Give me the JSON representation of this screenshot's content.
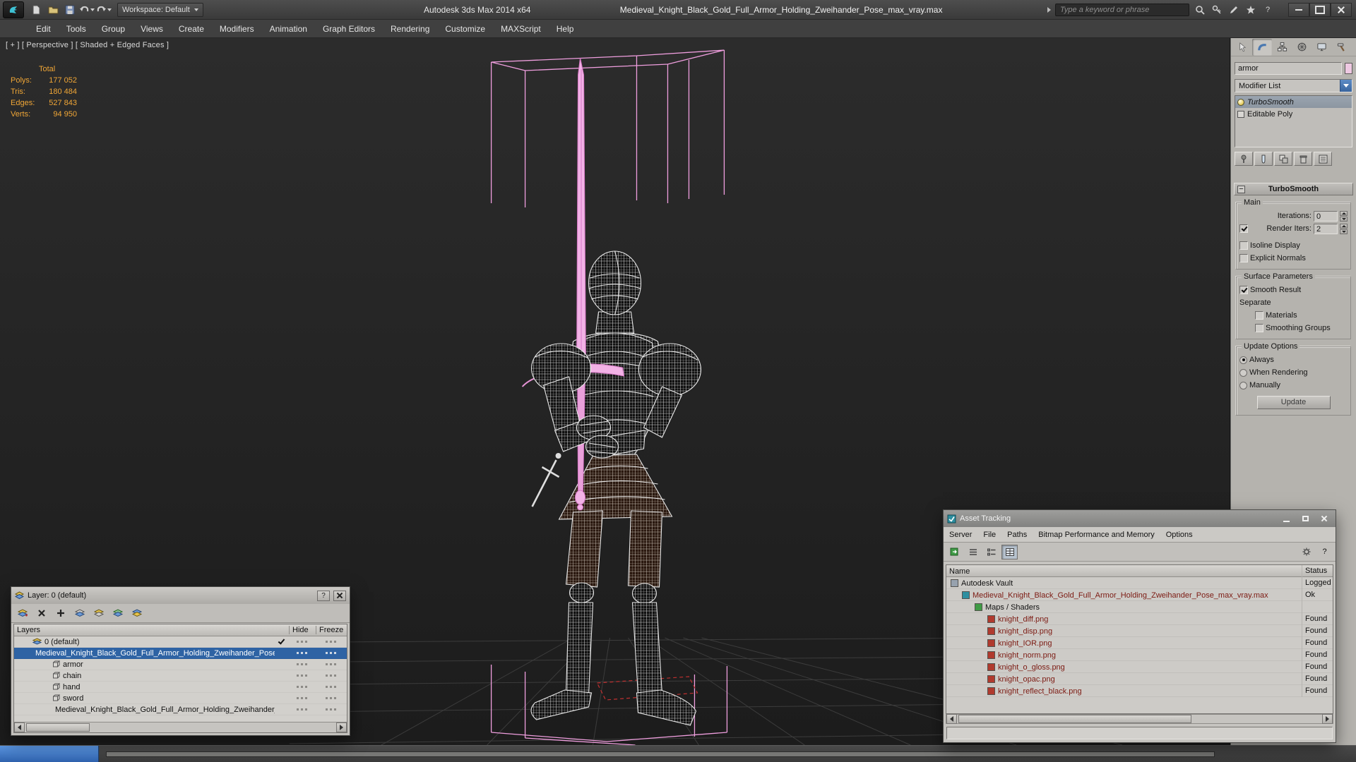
{
  "titlebar": {
    "app_title": "Autodesk 3ds Max 2014 x64",
    "doc_title": "Medieval_Knight_Black_Gold_Full_Armor_Holding_Zweihander_Pose_max_vray.max",
    "workspace_label": "Workspace: Default",
    "search_placeholder": "Type a keyword or phrase"
  },
  "menubar": {
    "items": [
      "Edit",
      "Tools",
      "Group",
      "Views",
      "Create",
      "Modifiers",
      "Animation",
      "Graph Editors",
      "Rendering",
      "Customize",
      "MAXScript",
      "Help"
    ]
  },
  "viewport": {
    "label": "[ + ] [ Perspective ] [ Shaded + Edged Faces ]",
    "stats": {
      "title": "Total",
      "rows": [
        {
          "label": "Polys:",
          "value": "177 052"
        },
        {
          "label": "Tris:",
          "value": "180 484"
        },
        {
          "label": "Edges:",
          "value": "527 843"
        },
        {
          "label": "Verts:",
          "value": "94 950"
        }
      ]
    }
  },
  "command_panel": {
    "object_name": "armor",
    "modifier_list_label": "Modifier List",
    "stack": [
      {
        "label": "TurboSmooth"
      },
      {
        "label": "Editable Poly"
      }
    ],
    "rollout_title": "TurboSmooth",
    "groups": {
      "main": "Main",
      "surface": "Surface Parameters",
      "update": "Update Options"
    },
    "labels": {
      "iterations": "Iterations:",
      "render_iters": "Render Iters:",
      "isoline": "Isoline Display",
      "explicit_normals": "Explicit Normals",
      "smooth_result": "Smooth Result",
      "separate": "Separate",
      "materials": "Materials",
      "smoothing_groups": "Smoothing Groups",
      "always": "Always",
      "when_rendering": "When Rendering",
      "manually": "Manually"
    },
    "values": {
      "iterations": "0",
      "render_iters": "2"
    },
    "update_button": "Update"
  },
  "layer_window": {
    "title": "Layer: 0 (default)",
    "columns": {
      "layers": "Layers",
      "hide": "Hide",
      "freeze": "Freeze"
    },
    "rows": [
      {
        "label": "0 (default)"
      },
      {
        "label": "Medieval_Knight_Black_Gold_Full_Armor_Holding_Zweihander_Pose"
      },
      {
        "label": "armor"
      },
      {
        "label": "chain"
      },
      {
        "label": "hand"
      },
      {
        "label": "sword"
      },
      {
        "label": "Medieval_Knight_Black_Gold_Full_Armor_Holding_Zweihander_Pose"
      }
    ]
  },
  "asset_window": {
    "title": "Asset Tracking",
    "menus": [
      "Server",
      "File",
      "Paths",
      "Bitmap Performance and Memory",
      "Options"
    ],
    "columns": {
      "name": "Name",
      "status": "Status"
    },
    "rows": [
      {
        "name": "Autodesk Vault",
        "status": "Logged Out"
      },
      {
        "name": "Medieval_Knight_Black_Gold_Full_Armor_Holding_Zweihander_Pose_max_vray.max",
        "status": "Ok"
      },
      {
        "name": "Maps / Shaders",
        "status": ""
      },
      {
        "name": "knight_diff.png",
        "status": "Found"
      },
      {
        "name": "knight_disp.png",
        "status": "Found"
      },
      {
        "name": "knight_IOR.png",
        "status": "Found"
      },
      {
        "name": "knight_norm.png",
        "status": "Found"
      },
      {
        "name": "knight_o_gloss.png",
        "status": "Found"
      },
      {
        "name": "knight_opac.png",
        "status": "Found"
      },
      {
        "name": "knight_reflect_black.png",
        "status": "Found"
      }
    ]
  },
  "glyphs": {
    "help": "?"
  },
  "colors": {
    "selection_pink": "#ef9ede",
    "highlight_blue": "#2e63a4",
    "stats_orange": "#f0a636",
    "wireframe": "#e9e9e9"
  }
}
